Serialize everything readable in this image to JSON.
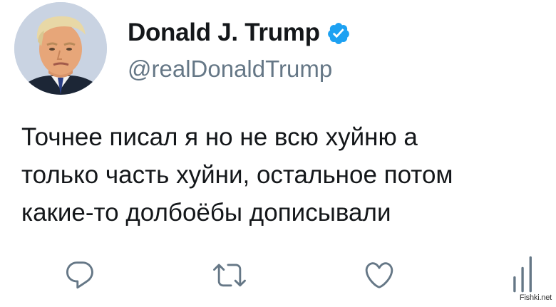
{
  "user": {
    "display_name": "Donald J. Trump",
    "handle": "@realDonaldTrump",
    "verified": true,
    "verified_color": "#1da1f2",
    "avatar_icon": "profile-photo"
  },
  "tweet": {
    "lines": [
      "Точнее писал я но не всю хуйню а",
      "только часть хуйни, остальное потом",
      "какие-то долбоёбы дописывали"
    ]
  },
  "actions": [
    {
      "name": "reply",
      "icon": "speech-bubble-icon"
    },
    {
      "name": "retweet",
      "icon": "retweet-arrows-icon"
    },
    {
      "name": "like",
      "icon": "heart-icon"
    },
    {
      "name": "analytics",
      "icon": "bar-chart-icon"
    }
  ],
  "colors": {
    "text": "#14171a",
    "secondary": "#657786",
    "icon": "#657786"
  },
  "watermark": "Fishki.net"
}
